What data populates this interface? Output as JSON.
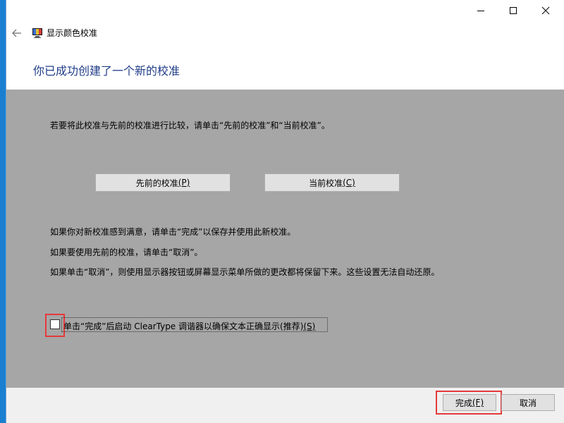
{
  "window": {
    "app_title": "显示颜色校准",
    "controls": {
      "minimize": "minimize-icon",
      "maximize": "maximize-icon",
      "close": "close-icon"
    }
  },
  "header": {
    "title": "你已成功创建了一个新的校准"
  },
  "content": {
    "compare_text": "若要将此校准与先前的校准进行比较，请单击“先前的校准”和“当前校准”。",
    "buttons": {
      "previous_label": "先前的校准",
      "previous_key": "(P)",
      "current_label": "当前校准",
      "current_key": "(C)"
    },
    "instructions": [
      "如果你对新校准感到满意，请单击“完成”以保存并使用此新校准。",
      "如果要使用先前的校准，请单击“取消”。",
      "如果单击“取消”，则使用显示器按钮或屏幕显示菜单所做的更改都将保留下来。这些设置无法自动还原。"
    ],
    "checkbox": {
      "label": "单击“完成”后启动 ClearType 调谐器以确保文本正确显示(推荐)",
      "key": "(S)",
      "checked": false
    }
  },
  "footer": {
    "finish_label": "完成",
    "finish_key": "(F)",
    "cancel_label": "取消"
  },
  "colors": {
    "content_bg": "#a6a6a6",
    "title_blue": "#1f3c88",
    "highlight_red": "#e5393b",
    "desktop_blue": "#1b7fd1"
  }
}
